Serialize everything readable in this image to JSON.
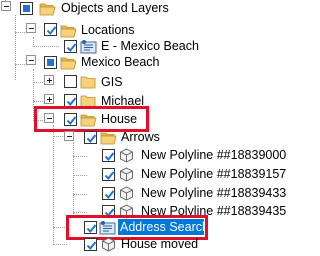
{
  "tree": {
    "root": {
      "label": "Objects and Layers"
    },
    "locations": {
      "label": "Locations"
    },
    "mexico_beach_loc": {
      "label": "E - Mexico Beach"
    },
    "mexico_beach": {
      "label": "Mexico Beach"
    },
    "gis": {
      "label": "GIS"
    },
    "michael": {
      "label": "Michael"
    },
    "house": {
      "label": "House"
    },
    "arrows": {
      "label": "Arrows"
    },
    "polylines": [
      {
        "label": "New Polyline ##18839000"
      },
      {
        "label": "New Polyline ##18839157"
      },
      {
        "label": "New Polyline ##18839433"
      },
      {
        "label": "New Polyline ##18839435"
      }
    ],
    "address_search": {
      "label": "Address Search",
      "selected": true
    },
    "house_moved": {
      "label": "House moved"
    }
  },
  "colors": {
    "selection": "#0078d7",
    "highlight_box": "#e0102a",
    "check": "#1e73d6"
  }
}
